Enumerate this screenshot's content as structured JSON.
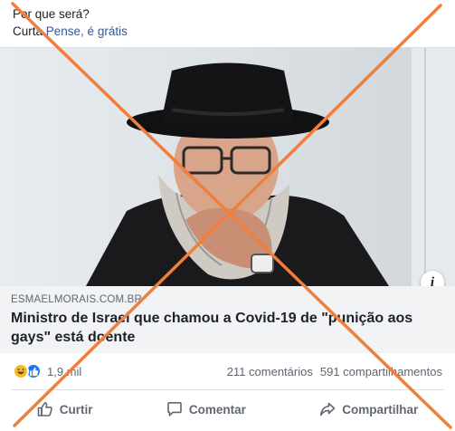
{
  "post": {
    "text": "Por que será?",
    "promo_prefix": "Curta",
    "promo_link": "Pense, é grátis"
  },
  "link_preview": {
    "domain": "ESMAELMORAIS.COM.BR",
    "headline": "Ministro de Israel que chamou a Covid-19 de \"punição aos gays\" está doente",
    "info_label": "i",
    "photo_icon": "photo-of-bearded-man-in-black-hat"
  },
  "stats": {
    "reaction_icons": [
      "haha-icon",
      "like-icon"
    ],
    "reaction_count": "1,9 mil",
    "comments": "211 comentários",
    "shares": "591 compartilhamentos"
  },
  "actions": {
    "like_label": "Curtir",
    "comment_label": "Comentar",
    "share_label": "Compartilhar"
  },
  "overlay": {
    "cross_color": "#f07f3c"
  }
}
